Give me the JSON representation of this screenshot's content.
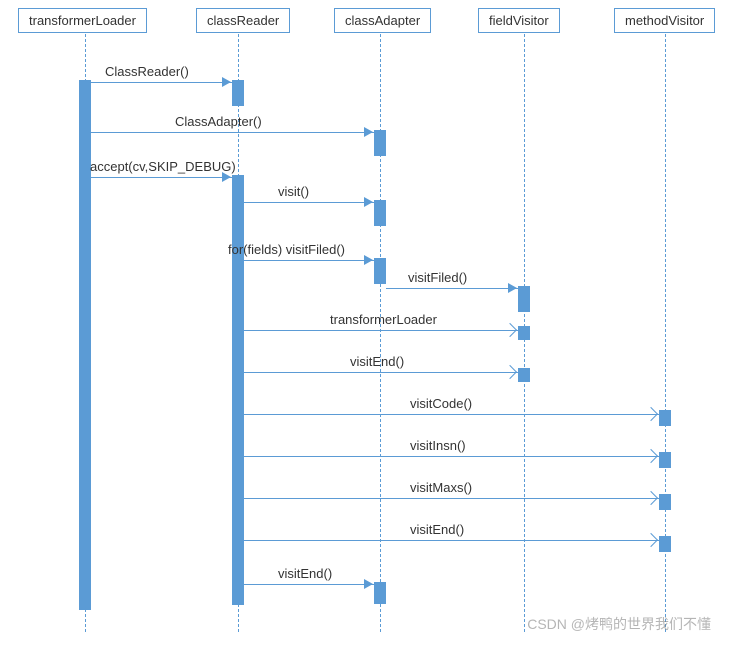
{
  "participants": {
    "p1": "transformerLoader",
    "p2": "classReader",
    "p3": "classAdapter",
    "p4": "fieldVisitor",
    "p5": "methodVisitor"
  },
  "messages": {
    "m1": "ClassReader()",
    "m2": "ClassAdapter()",
    "m3": "accept(cv,SKIP_DEBUG)",
    "m4": "visit()",
    "m5": "for(fields) visitFiled()",
    "m6": "visitFiled()",
    "m7": "transformerLoader",
    "m8": "visitEnd()",
    "m9": "visitCode()",
    "m10": "visitInsn()",
    "m11": "visitMaxs()",
    "m12": "visitEnd()",
    "m13": "visitEnd()"
  },
  "watermark": "CSDN @烤鸭的世界我们不懂",
  "chart_data": {
    "type": "sequence-diagram",
    "participants": [
      "transformerLoader",
      "classReader",
      "classAdapter",
      "fieldVisitor",
      "methodVisitor"
    ],
    "messages": [
      {
        "from": "transformerLoader",
        "to": "classReader",
        "label": "ClassReader()",
        "kind": "sync"
      },
      {
        "from": "transformerLoader",
        "to": "classAdapter",
        "label": "ClassAdapter()",
        "kind": "sync"
      },
      {
        "from": "transformerLoader",
        "to": "classReader",
        "label": "accept(cv,SKIP_DEBUG)",
        "kind": "sync"
      },
      {
        "from": "classReader",
        "to": "classAdapter",
        "label": "visit()",
        "kind": "sync"
      },
      {
        "from": "classReader",
        "to": "classAdapter",
        "label": "for(fields) visitFiled()",
        "kind": "sync"
      },
      {
        "from": "classAdapter",
        "to": "fieldVisitor",
        "label": "visitFiled()",
        "kind": "sync"
      },
      {
        "from": "classReader",
        "to": "fieldVisitor",
        "label": "transformerLoader",
        "kind": "async"
      },
      {
        "from": "classReader",
        "to": "fieldVisitor",
        "label": "visitEnd()",
        "kind": "async"
      },
      {
        "from": "classReader",
        "to": "methodVisitor",
        "label": "visitCode()",
        "kind": "async"
      },
      {
        "from": "classReader",
        "to": "methodVisitor",
        "label": "visitInsn()",
        "kind": "async"
      },
      {
        "from": "classReader",
        "to": "methodVisitor",
        "label": "visitMaxs()",
        "kind": "async"
      },
      {
        "from": "classReader",
        "to": "methodVisitor",
        "label": "visitEnd()",
        "kind": "async"
      },
      {
        "from": "classReader",
        "to": "classAdapter",
        "label": "visitEnd()",
        "kind": "sync"
      }
    ]
  }
}
